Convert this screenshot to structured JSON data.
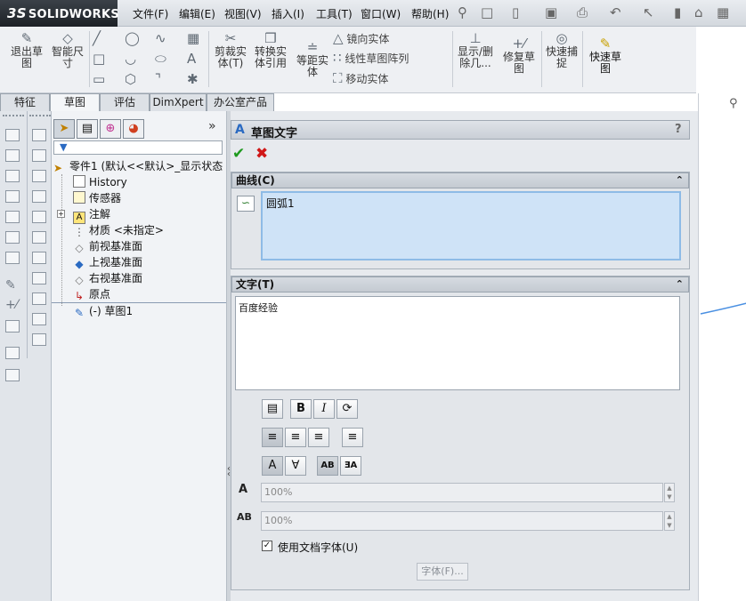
{
  "app": {
    "logo_ds": "3S",
    "logo_name": "SOLIDWORKS"
  },
  "menu": [
    "文件(F)",
    "编辑(E)",
    "视图(V)",
    "插入(I)",
    "工具(T)",
    "窗口(W)",
    "帮助(H)"
  ],
  "command": {
    "exit_sketch": "退出草\n图",
    "smart_dim": "智能尺\n寸",
    "trim": "剪裁实\n体(T)",
    "convert": "转换实\n体引用",
    "offset": "等距实\n体",
    "mirror": "镜向实体",
    "linear_pattern": "线性草图阵列",
    "move": "移动实体",
    "show_hide": "显示/删\n除几...",
    "repair": "修复草\n图",
    "quick_snap": "快速捕\n捉",
    "rapid_sketch": "快速草\n图"
  },
  "tabs": [
    "特征",
    "草图",
    "评估",
    "DimXpert",
    "办公室产品"
  ],
  "tree": {
    "part": "零件1 (默认<<默认>_显示状态",
    "items": [
      "History",
      "传感器",
      "注解",
      "材质 <未指定>",
      "前视基准面",
      "上视基准面",
      "右视基准面",
      "原点",
      "(-) 草图1"
    ]
  },
  "pm": {
    "title": "草图文字",
    "help": "?",
    "curve_section": "曲线(C)",
    "curve_value": "圆弧1",
    "text_section": "文字(T)",
    "text_value": "百度经验",
    "width_value": "100%",
    "spacing_value": "100%",
    "use_doc_font": "使用文档字体(U)",
    "font_button": "字体(F)..."
  },
  "colors": {
    "accent": "#2a6ac2",
    "panel_bg": "#e7eaee",
    "list_bg": "#cfe3f7"
  }
}
